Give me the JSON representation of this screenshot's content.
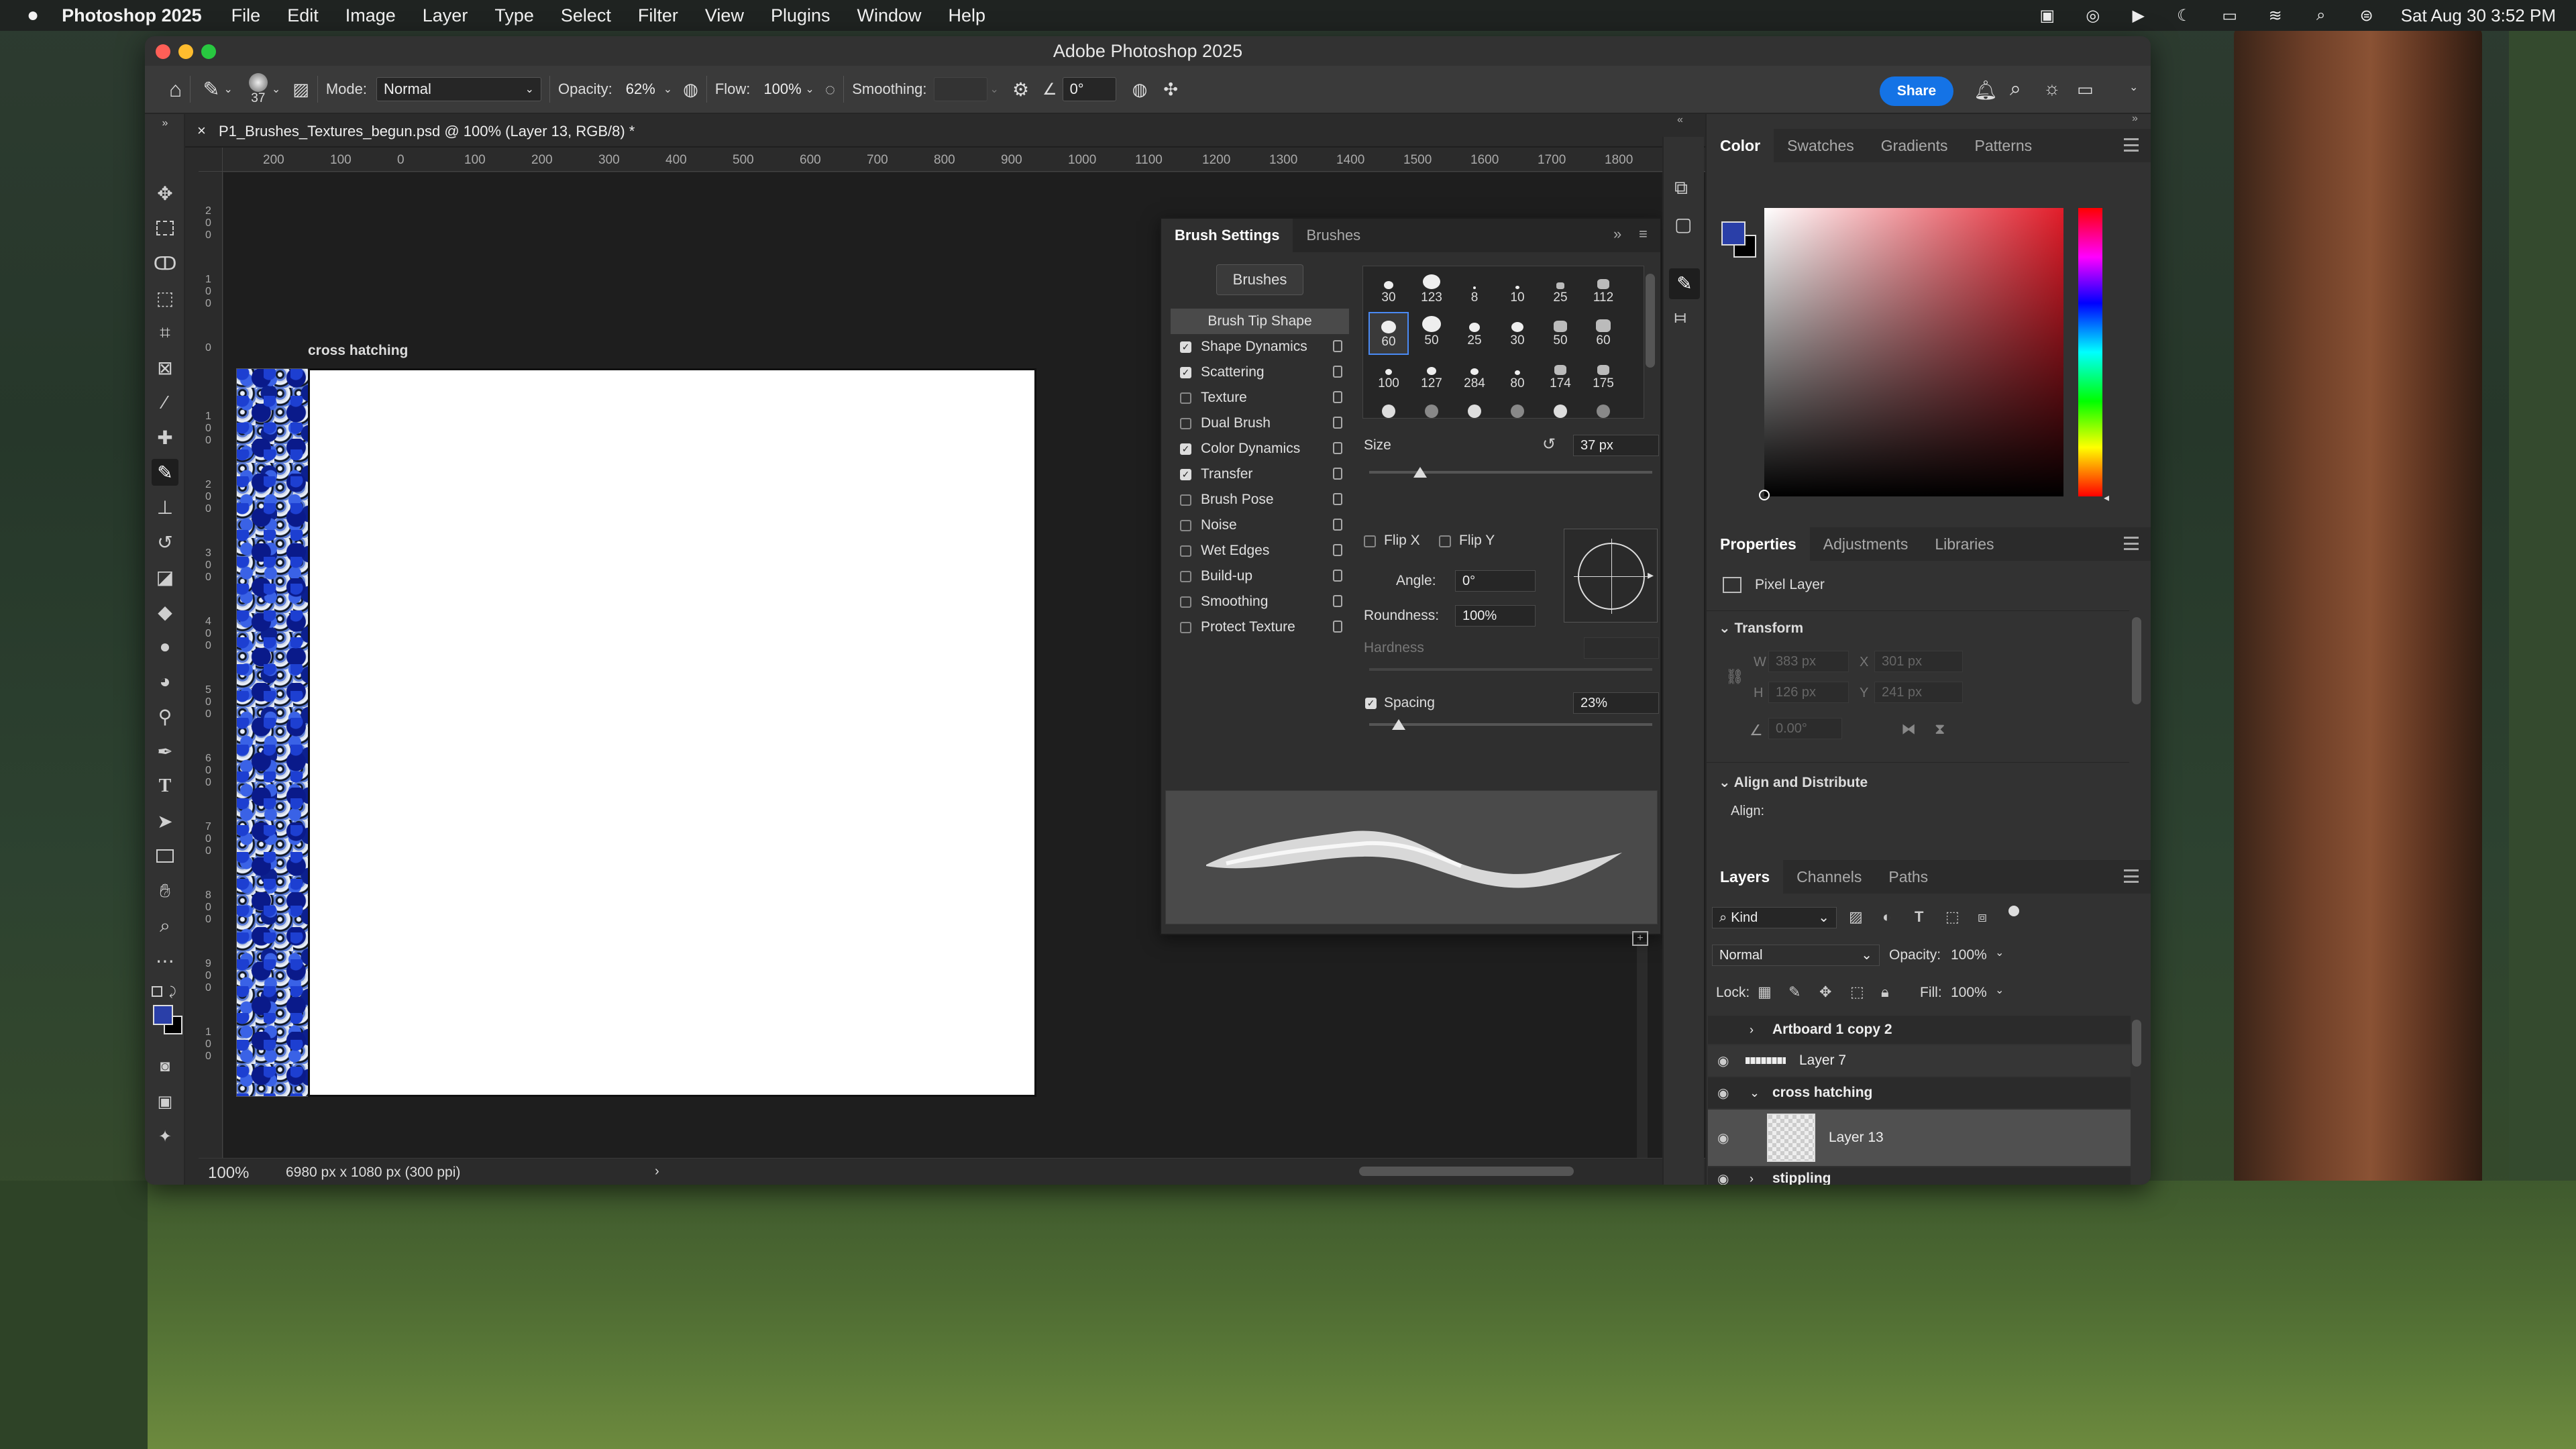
{
  "menubar": {
    "app_name": "Photoshop 2025",
    "items": [
      "File",
      "Edit",
      "Image",
      "Layer",
      "Type",
      "Select",
      "Filter",
      "View",
      "Plugins",
      "Window",
      "Help"
    ],
    "clock": "Sat Aug 30  3:52 PM"
  },
  "window": {
    "title": "Adobe Photoshop 2025"
  },
  "options_bar": {
    "brush_size": "37",
    "mode_label": "Mode:",
    "mode_value": "Normal",
    "opacity_label": "Opacity:",
    "opacity_value": "62%",
    "flow_label": "Flow:",
    "flow_value": "100%",
    "smoothing_label": "Smoothing:",
    "smoothing_value": "",
    "angle_value": "0°",
    "share_label": "Share"
  },
  "document": {
    "tab_title": "P1_Brushes_Textures_begun.psd @ 100% (Layer 13, RGB/8) *",
    "artboard_label": "cross hatching",
    "h_ruler": [
      "200",
      "100",
      "0",
      "100",
      "200",
      "300",
      "400",
      "500",
      "600",
      "700",
      "800",
      "900",
      "1000",
      "1100",
      "1200",
      "1300",
      "1400",
      "1500",
      "1600",
      "1700",
      "1800"
    ],
    "v_ruler": [
      "2\n0\n0",
      "1\n0\n0",
      "0",
      "1\n0\n0",
      "2\n0\n0",
      "3\n0\n0",
      "4\n0\n0",
      "5\n0\n0",
      "6\n0\n0",
      "7\n0\n0",
      "8\n0\n0",
      "9\n0\n0",
      "1\n0\n0"
    ],
    "zoom": "100%",
    "dimensions": "6980 px x 1080 px (300 ppi)"
  },
  "brush_settings": {
    "tab_active": "Brush Settings",
    "tab_other": "Brushes",
    "brushes_button": "Brushes",
    "options": [
      {
        "label": "Brush Tip Shape",
        "checkbox": false,
        "checked": false,
        "selected": true
      },
      {
        "label": "Shape Dynamics",
        "checkbox": true,
        "checked": true
      },
      {
        "label": "Scattering",
        "checkbox": true,
        "checked": true
      },
      {
        "label": "Texture",
        "checkbox": true,
        "checked": false
      },
      {
        "label": "Dual Brush",
        "checkbox": true,
        "checked": false
      },
      {
        "label": "Color Dynamics",
        "checkbox": true,
        "checked": true
      },
      {
        "label": "Transfer",
        "checkbox": true,
        "checked": true
      },
      {
        "label": "Brush Pose",
        "checkbox": true,
        "checked": false
      },
      {
        "label": "Noise",
        "checkbox": true,
        "checked": false
      },
      {
        "label": "Wet Edges",
        "checkbox": true,
        "checked": false
      },
      {
        "label": "Build-up",
        "checkbox": true,
        "checked": false
      },
      {
        "label": "Smoothing",
        "checkbox": true,
        "checked": false
      },
      {
        "label": "Protect Texture",
        "checkbox": true,
        "checked": false
      }
    ],
    "tips": [
      "30",
      "123",
      "8",
      "10",
      "25",
      "112",
      "60",
      "50",
      "25",
      "30",
      "50",
      "60",
      "100",
      "127",
      "284",
      "80",
      "174",
      "175"
    ],
    "size_label": "Size",
    "size_value": "37 px",
    "flip_x": "Flip X",
    "flip_y": "Flip Y",
    "angle_label": "Angle:",
    "angle_value": "0°",
    "roundness_label": "Roundness:",
    "roundness_value": "100%",
    "hardness_label": "Hardness",
    "spacing_label": "Spacing",
    "spacing_value": "23%"
  },
  "color_panel": {
    "tabs": [
      "Color",
      "Swatches",
      "Gradients",
      "Patterns"
    ],
    "foreground": "#2a3fa8",
    "background": "#000000"
  },
  "properties_panel": {
    "tabs": [
      "Properties",
      "Adjustments",
      "Libraries"
    ],
    "layer_type": "Pixel Layer",
    "transform_label": "Transform",
    "w_label": "W",
    "w_value": "383 px",
    "x_label": "X",
    "x_value": "301 px",
    "h_label": "H",
    "h_value": "126 px",
    "y_label": "Y",
    "y_value": "241 px",
    "angle_value": "0.00°",
    "align_label": "Align and Distribute",
    "align_sub": "Align:"
  },
  "layers_panel": {
    "tabs": [
      "Layers",
      "Channels",
      "Paths"
    ],
    "filter_kind": "Kind",
    "blend_mode": "Normal",
    "opacity_label": "Opacity:",
    "opacity_value": "100%",
    "lock_label": "Lock:",
    "fill_label": "Fill:",
    "fill_value": "100%",
    "layers": [
      {
        "name": "Artboard 1 copy 2",
        "type": "artboard-collapsed"
      },
      {
        "name": "Layer 7",
        "type": "layer"
      },
      {
        "name": "cross hatching",
        "type": "artboard-expanded"
      },
      {
        "name": "Layer 13",
        "type": "layer-selected"
      },
      {
        "name": "stippling",
        "type": "artboard-collapsed"
      }
    ]
  }
}
